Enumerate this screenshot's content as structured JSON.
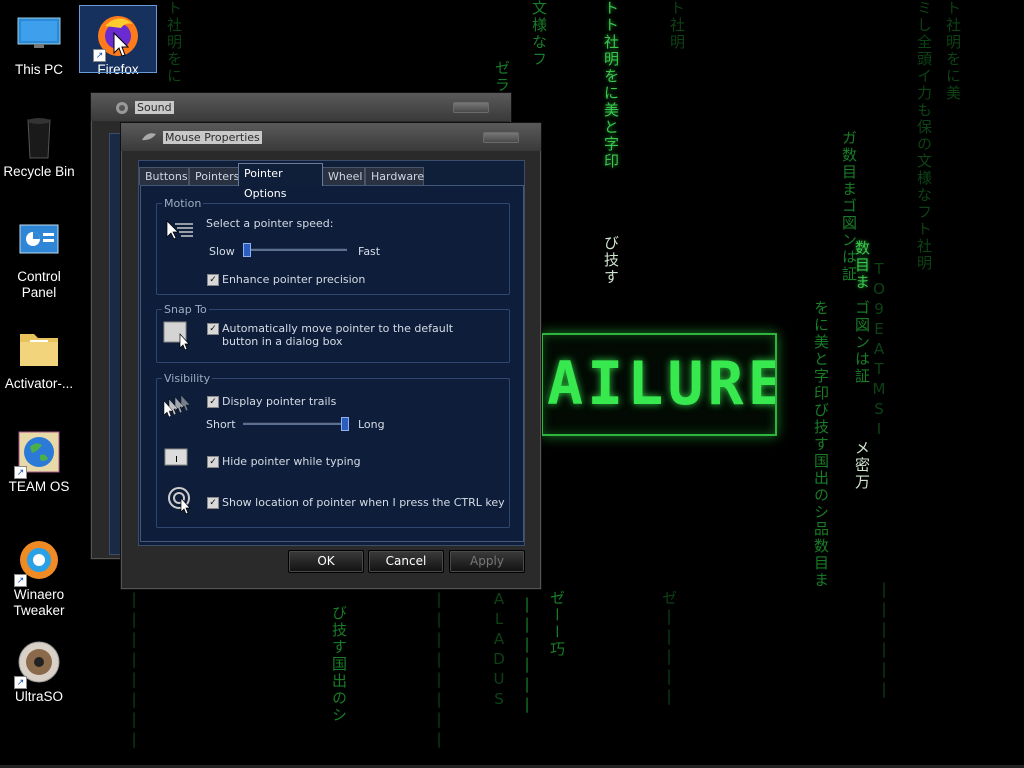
{
  "desktop": {
    "icons": [
      {
        "label": "This PC"
      },
      {
        "label": "Firefox"
      },
      {
        "label": "Recycle Bin"
      },
      {
        "label": "Control Panel"
      },
      {
        "label": "Activator-..."
      },
      {
        "label": "TEAM OS"
      },
      {
        "label": "Winaero Tweaker"
      },
      {
        "label": "UltraSO"
      }
    ],
    "wallpaper_text": "AILURE"
  },
  "sound_window": {
    "title": "Sound"
  },
  "mouse_dialog": {
    "title": "Mouse Properties",
    "tabs": [
      "Buttons",
      "Pointers",
      "Pointer Options",
      "Wheel",
      "Hardware"
    ],
    "active_tab": "Pointer Options",
    "motion": {
      "group_title": "Motion",
      "speed_label": "Select a pointer speed:",
      "slow_label": "Slow",
      "fast_label": "Fast",
      "speed_value": 0.0,
      "enhance_label": "Enhance pointer precision",
      "enhance_checked": true
    },
    "snap": {
      "group_title": "Snap To",
      "auto_label": "Automatically move pointer to the default button in a dialog box",
      "auto_checked": true
    },
    "visibility": {
      "group_title": "Visibility",
      "trails_label": "Display pointer trails",
      "trails_checked": true,
      "short_label": "Short",
      "long_label": "Long",
      "trails_value": 1.0,
      "hide_label": "Hide pointer while typing",
      "hide_checked": true,
      "ctrl_label": "Show location of pointer when I press the CTRL key",
      "ctrl_checked": true
    },
    "buttons": {
      "ok": "OK",
      "cancel": "Cancel",
      "apply": "Apply"
    }
  },
  "colors": {
    "matrix_green": "#37e84f",
    "dialog_blue": "#0e1e3a"
  }
}
